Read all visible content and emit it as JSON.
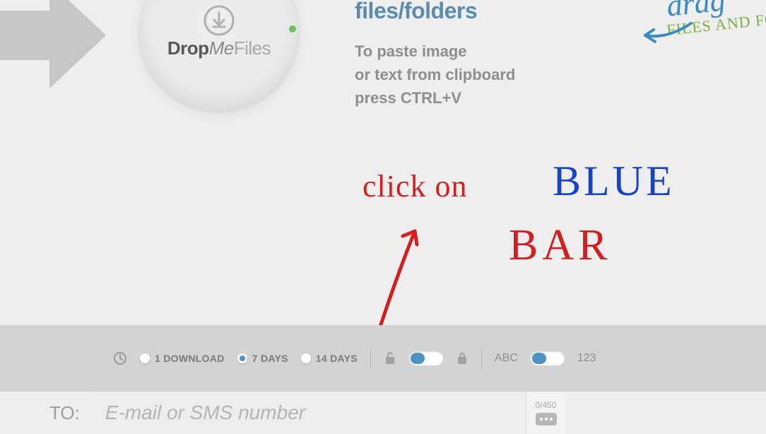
{
  "logo": {
    "part_drop": "Drop",
    "part_me": "Me",
    "part_files": "Files"
  },
  "header": {
    "subtitle": "files/folders",
    "paste_line1": "To paste image",
    "paste_line2": "or text from clipboard",
    "paste_line3": "press CTRL+V"
  },
  "drag_note": {
    "word": "drag",
    "sub": "FILES AND FOL"
  },
  "annotations": {
    "click_on": "click on",
    "blue": "BLUE",
    "bar": "BAR"
  },
  "options": {
    "one_download": "1 DOWNLOAD",
    "seven_days": "7 DAYS",
    "fourteen_days": "14 DAYS",
    "abc": "ABC",
    "num": "123"
  },
  "compose": {
    "to_label": "TO:",
    "placeholder": "E-mail or SMS number",
    "counter": "0/450"
  }
}
